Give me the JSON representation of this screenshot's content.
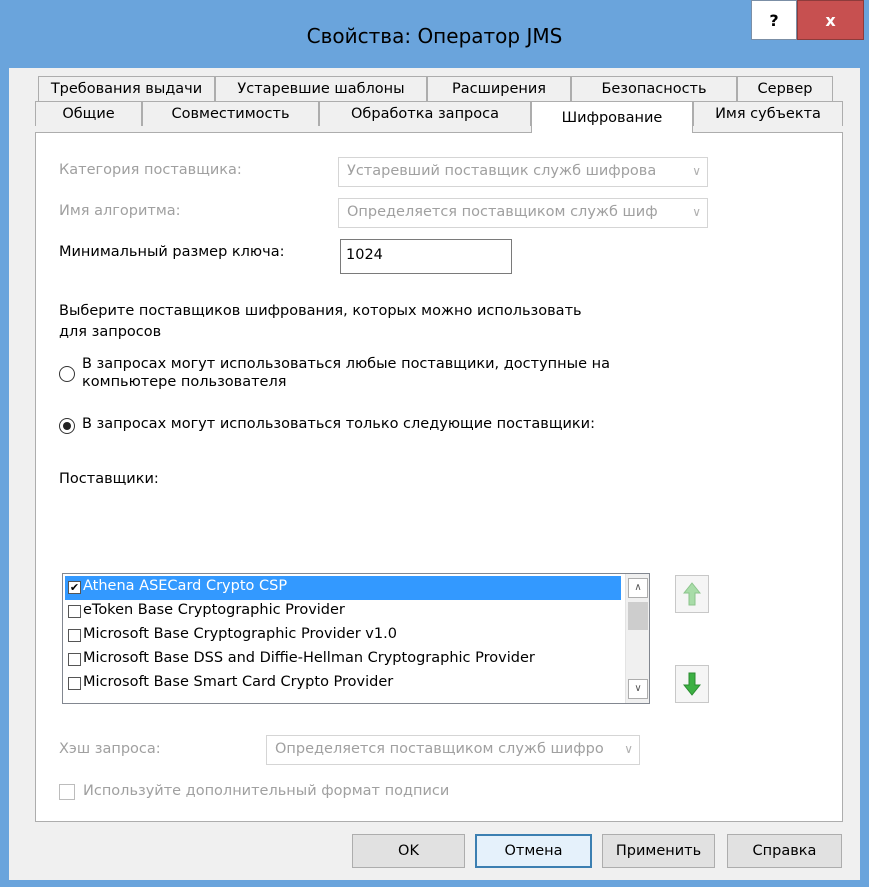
{
  "window": {
    "title": "Свойства: Оператор JMS",
    "help_label": "?",
    "close_label": "x"
  },
  "tabs_row1": [
    "Требования выдачи",
    "Устаревшие шаблоны",
    "Расширения",
    "Безопасность",
    "Сервер"
  ],
  "tabs_row2": [
    "Общие",
    "Совместимость",
    "Обработка запроса",
    "Шифрование",
    "Имя субъекта"
  ],
  "active_tab": "Шифрование",
  "form": {
    "provider_category_label": "Категория поставщика:",
    "provider_category_value": "Устаревший поставщик служб шифрова",
    "algorithm_label": "Имя алгоритма:",
    "algorithm_value": "Определяется поставщиком служб шиф",
    "min_key_label": "Минимальный размер ключа:",
    "min_key_value": "1024",
    "choose_text_line1": "Выберите поставщиков шифрования, которых можно использовать",
    "choose_text_line2": "для запросов",
    "radio_any_line1": "В запросах могут использоваться любые поставщики, доступные на",
    "radio_any_line2": "компьютере пользователя",
    "radio_only": "В запросах могут использоваться только следующие поставщики:",
    "providers_label": "Поставщики:",
    "providers": [
      {
        "name": "Athena ASECard Crypto CSP",
        "checked": true,
        "selected": true
      },
      {
        "name": "eToken Base Cryptographic Provider",
        "checked": false,
        "selected": false
      },
      {
        "name": "Microsoft Base Cryptographic Provider v1.0",
        "checked": false,
        "selected": false
      },
      {
        "name": "Microsoft Base DSS and Diffie-Hellman Cryptographic Provider",
        "checked": false,
        "selected": false
      },
      {
        "name": "Microsoft Base Smart Card Crypto Provider",
        "checked": false,
        "selected": false
      }
    ],
    "hash_label": "Хэш запроса:",
    "hash_value": "Определяется поставщиком служб шифро",
    "alt_sig_label": "Используйте дополнительный формат подписи"
  },
  "buttons": {
    "ok": "OK",
    "cancel": "Отмена",
    "apply": "Применить",
    "help": "Справка"
  },
  "colors": {
    "title_bar": "#6aa4dc",
    "close_button": "#c75050",
    "selection": "#3399ff",
    "arrow_green": "#3cb043"
  }
}
